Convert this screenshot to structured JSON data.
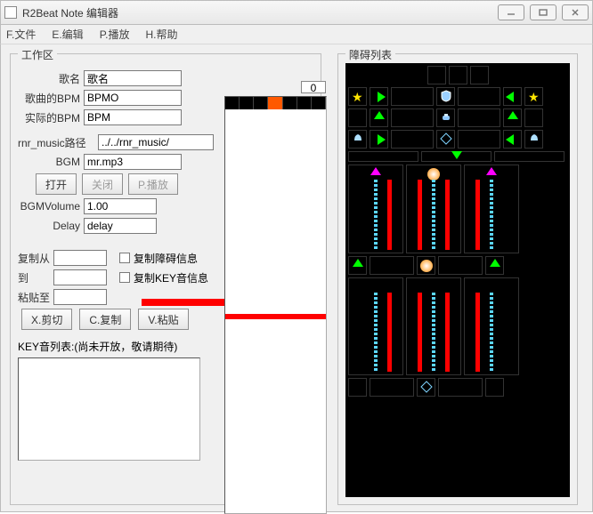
{
  "window": {
    "title": "R2Beat Note 编辑器"
  },
  "menu": {
    "file": "F.文件",
    "edit": "E.编辑",
    "play": "P.播放",
    "help": "H.帮助"
  },
  "work": {
    "legend": "工作区",
    "songname_label": "歌名",
    "songname_value": "歌名",
    "songbpm_label": "歌曲的BPM",
    "songbpm_value": "BPMO",
    "realbpm_label": "实际的BPM",
    "realbpm_value": "BPM",
    "rnrpath_label": "rnr_music路径",
    "rnrpath_value": "../../rnr_music/",
    "bgm_label": "BGM",
    "bgm_value": "mr.mp3",
    "open_btn": "打开",
    "close_btn": "关闭",
    "play_btn": "P.播放",
    "bgmvol_label": "BGMVolume",
    "bgmvol_value": "1.00",
    "delay_label": "Delay",
    "delay_value": "delay",
    "copyfrom_label": "复制从",
    "copyto_label": "到",
    "pasteto_label": "粘贴至",
    "copy_obst_chk": "复制障碍信息",
    "copy_key_chk": "复制KEY音信息",
    "cut_btn": "X.剪切",
    "copy_btn": "C.复制",
    "paste_btn": "V.粘贴",
    "keylist_label": "KEY音列表:(尚未开放，敬请期待)"
  },
  "timeline": {
    "counter": "0"
  },
  "obst": {
    "legend": "障碍列表"
  }
}
